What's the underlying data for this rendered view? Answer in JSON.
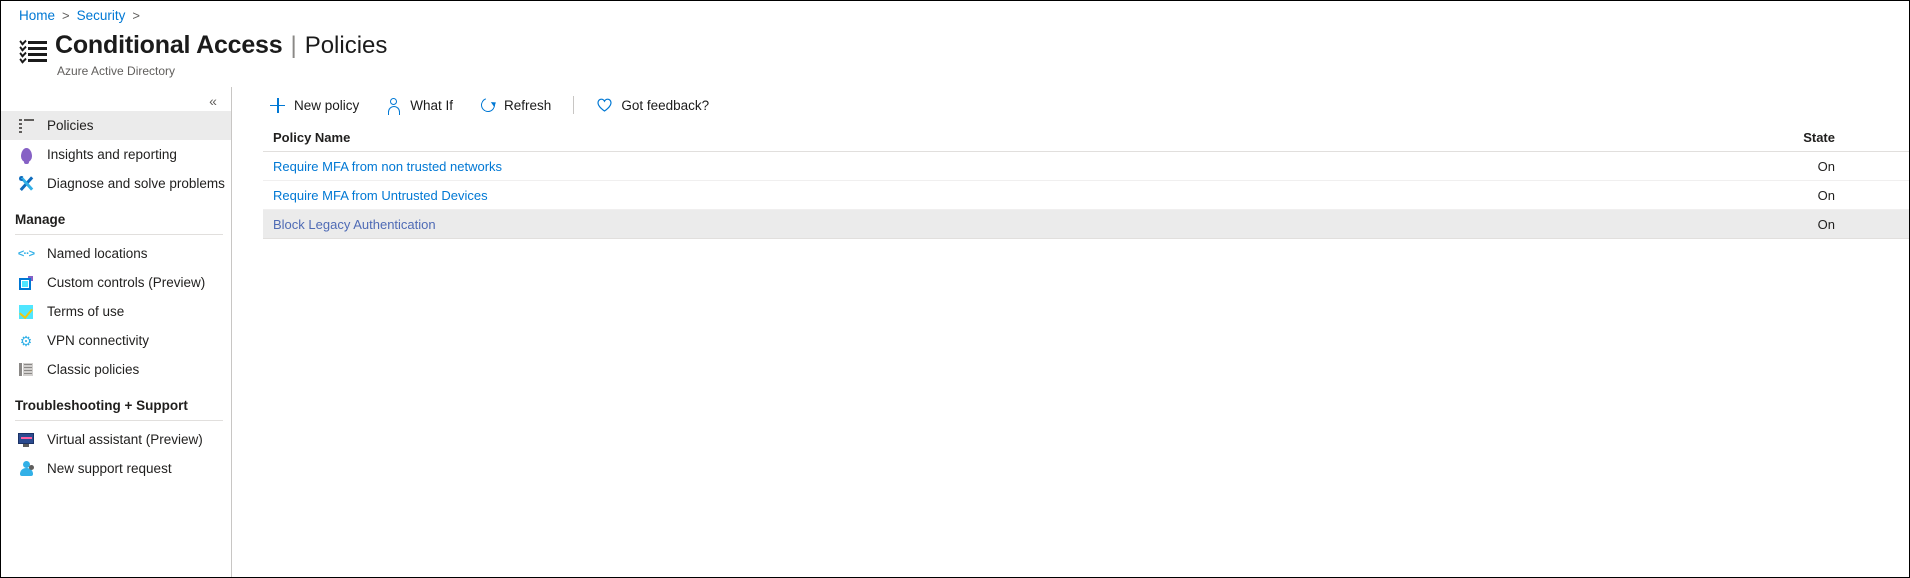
{
  "breadcrumb": {
    "items": [
      "Home",
      "Security"
    ],
    "separator": ">"
  },
  "header": {
    "icon": "policy-list-icon",
    "title": "Conditional Access",
    "divider": "|",
    "subtitle": "Policies",
    "caption": "Azure Active Directory"
  },
  "sidebar": {
    "collapse_label": "«",
    "items": [
      {
        "label": "Policies",
        "icon": "list-icon",
        "selected": true
      },
      {
        "label": "Insights and reporting",
        "icon": "lightbulb-icon",
        "selected": false
      },
      {
        "label": "Diagnose and solve problems",
        "icon": "wrench-icon",
        "selected": false
      }
    ],
    "groups": [
      {
        "title": "Manage",
        "items": [
          {
            "label": "Named locations",
            "icon": "angle-brackets-icon"
          },
          {
            "label": "Custom controls (Preview)",
            "icon": "custom-control-icon"
          },
          {
            "label": "Terms of use",
            "icon": "checkbox-icon"
          },
          {
            "label": "VPN connectivity",
            "icon": "gear-icon"
          },
          {
            "label": "Classic policies",
            "icon": "classic-list-icon"
          }
        ]
      },
      {
        "title": "Troubleshooting + Support",
        "items": [
          {
            "label": "Virtual assistant (Preview)",
            "icon": "monitor-icon"
          },
          {
            "label": "New support request",
            "icon": "support-person-icon"
          }
        ]
      }
    ]
  },
  "toolbar": {
    "new_policy_label": "New policy",
    "what_if_label": "What If",
    "refresh_label": "Refresh",
    "feedback_label": "Got feedback?",
    "icons": {
      "new_policy": "plus-icon",
      "what_if": "person-icon",
      "refresh": "refresh-icon",
      "feedback": "heart-icon"
    }
  },
  "table": {
    "columns": [
      "Policy Name",
      "State"
    ],
    "rows": [
      {
        "name": "Require MFA from non trusted networks",
        "state": "On",
        "visited": false,
        "highlight": false
      },
      {
        "name": "Require MFA from Untrusted Devices",
        "state": "On",
        "visited": false,
        "highlight": false
      },
      {
        "name": "Block Legacy Authentication",
        "state": "On",
        "visited": true,
        "highlight": true
      }
    ]
  },
  "colors": {
    "accent": "#0078d4",
    "link": "#0078d4",
    "visited_link": "#4f6bb5",
    "row_highlight": "#ebebeb",
    "purple": "#8661c5",
    "cyan": "#50e6ff"
  }
}
